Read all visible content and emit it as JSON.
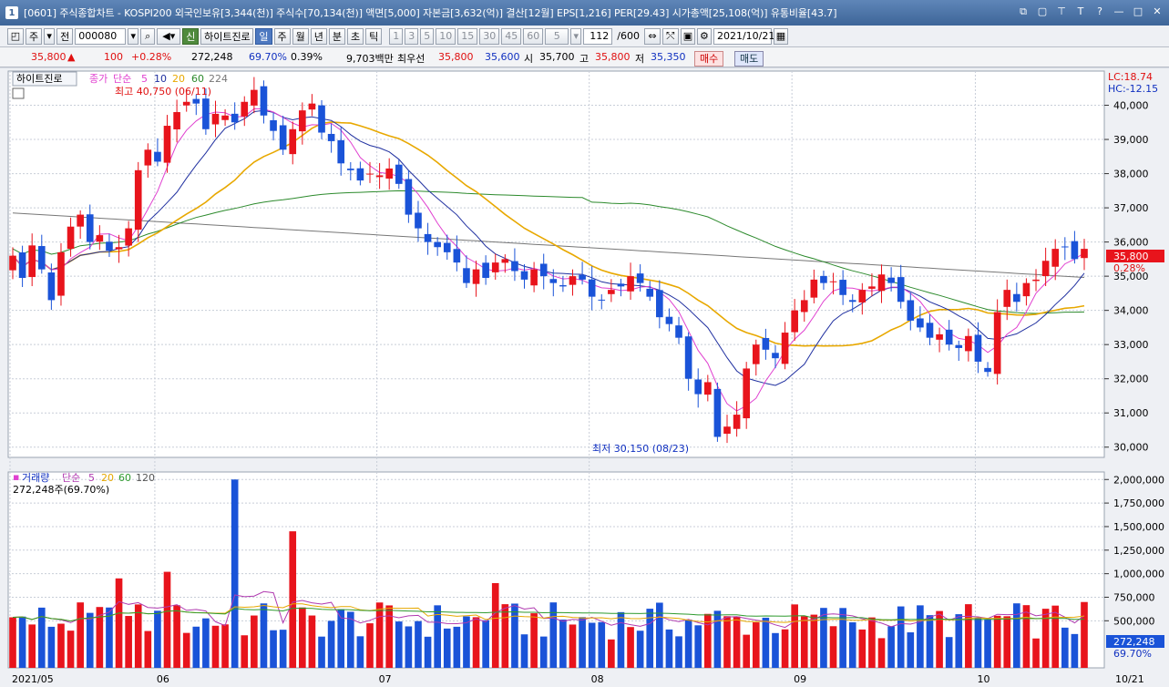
{
  "window": {
    "app_number": "1",
    "title": "[0601] 주식종합차트 - KOSPI200 외국인보유[3,344(천)] 주식수[70,134(천)] 액면[5,000] 자본금[3,632(억)] 결산[12월] EPS[1,216] PER[29.43] 시가총액[25,108(억)] 유통비율[43.7]",
    "buttons": [
      "⧉",
      "▢",
      "⊤",
      "T",
      "?",
      "—",
      "□",
      "✕"
    ]
  },
  "toolbar": {
    "period_type": "주",
    "prev_label": "전",
    "code": "000080",
    "stock_name": "하이트진로",
    "new_badge": "신",
    "periods": [
      "일",
      "주",
      "월",
      "년",
      "분",
      "초",
      "틱"
    ],
    "selected_period": "일",
    "minutes": [
      "1",
      "3",
      "5",
      "10",
      "15",
      "30",
      "45",
      "60"
    ],
    "interval": "5",
    "count": "112",
    "count_total": "/600",
    "date": "2021/10/21"
  },
  "quote": {
    "price": "35,800",
    "change": "100",
    "change_pct": "+0.28%",
    "volume": "272,248",
    "vol_ratio": "69.70%",
    "turnover_pct": "0.39%",
    "amount": "9,703백만",
    "best_label": "최우선",
    "best_ask": "35,800",
    "best_bid": "35,600",
    "open_label": "시",
    "open": "35,700",
    "high_label": "고",
    "high": "35,800",
    "low_label": "저",
    "low": "35,350",
    "buy_label": "매수",
    "sell_label": "매도"
  },
  "chart_data": {
    "type": "candlestick",
    "price_legend": {
      "name": "하이트진로",
      "price_label": "종가",
      "ma_type": "단순",
      "ma": [
        "5",
        "10",
        "20",
        "60",
        "224"
      ]
    },
    "volume_legend": {
      "name": "거래량",
      "ma_type": "단순",
      "ma": [
        "5",
        "20",
        "60",
        "120"
      ],
      "last": "272,248주(69.70%)"
    },
    "annotations": {
      "high": "최고 40,750 (06/11)",
      "low": "최저 30,150 (08/23)",
      "lc": "LC:18.74",
      "hc": "HC:-12.15"
    },
    "price_axis": {
      "ticks": [
        30000,
        31000,
        32000,
        33000,
        34000,
        35000,
        36000,
        37000,
        38000,
        39000,
        40000
      ],
      "labels": [
        "30,000",
        "31,000",
        "32,000",
        "33,000",
        "34,000",
        "35,000",
        "36,000",
        "37,000",
        "38,000",
        "39,000",
        "40,000"
      ],
      "range": [
        29700,
        41000
      ],
      "current": "35,800",
      "current_pct": "0.28%"
    },
    "volume_axis": {
      "ticks": [
        500000,
        750000,
        1000000,
        1250000,
        1500000,
        1750000,
        2000000
      ],
      "labels": [
        "500,000",
        "750,000",
        "1,000,000",
        "1,250,000",
        "1,500,000",
        "1,750,000",
        "2,000,000"
      ],
      "max": 2080000,
      "current": "272,248",
      "current_pct": "69.70%"
    },
    "x_labels": [
      {
        "i": 0,
        "t": "2021/05"
      },
      {
        "i": 15,
        "t": "06"
      },
      {
        "i": 38,
        "t": "07"
      },
      {
        "i": 60,
        "t": "08"
      },
      {
        "i": 81,
        "t": "09"
      },
      {
        "i": 100,
        "t": "10"
      }
    ],
    "last_date": "10/21",
    "closes": [
      35600,
      34950,
      35900,
      35200,
      34300,
      35700,
      36450,
      36800,
      36000,
      36200,
      35750,
      35850,
      36400,
      38100,
      38700,
      38350,
      39400,
      39800,
      40100,
      40050,
      39300,
      39750,
      39700,
      39500,
      40100,
      40450,
      39700,
      39250,
      38700,
      39300,
      39850,
      40050,
      39200,
      38950,
      38300,
      38100,
      37800,
      38000,
      37950,
      38150,
      37700,
      36800,
      36400,
      36000,
      35850,
      35700,
      35400,
      34800,
      35200,
      34950,
      35400,
      35500,
      35150,
      34900,
      35200,
      35000,
      34800,
      34700,
      35000,
      34900,
      34400,
      34300,
      34600,
      34700,
      35000,
      34800,
      34400,
      33800,
      33600,
      33200,
      32000,
      31550,
      31900,
      30300,
      30600,
      30950,
      32300,
      33000,
      32850,
      32600,
      33350,
      34000,
      34300,
      34900,
      34800,
      34850,
      34450,
      34250,
      34600,
      34700,
      35050,
      34800,
      34250,
      33700,
      33500,
      33200,
      33300,
      33000,
      32900,
      33250,
      32500,
      32200,
      33950,
      34600,
      34250,
      34800,
      34900,
      35450,
      35800,
      35850,
      35500,
      35800
    ],
    "volume_ma": {
      "ma5_color": "#b03ab0",
      "ma20_color": "#e6a800",
      "ma60_color": "#2e9a2e",
      "ma120_color": "#555555"
    }
  },
  "colors": {
    "up": "#e8141c",
    "down": "#1a53d8",
    "ma5": "#e040d0",
    "ma10": "#2030a0",
    "ma20": "#e8a800",
    "ma60": "#2c8a2c",
    "ma224": "#777777",
    "grid": "#c8ced8"
  }
}
